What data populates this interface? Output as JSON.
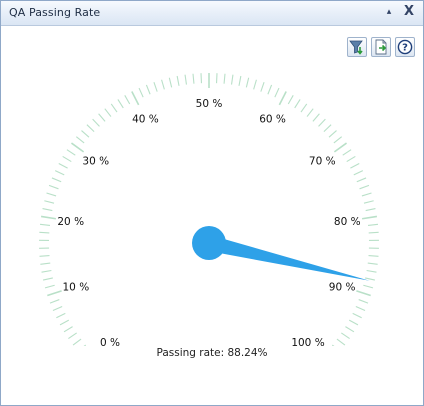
{
  "window": {
    "title": "QA Passing Rate",
    "pin_glyph": "▴",
    "close_glyph": "X"
  },
  "toolbar": {
    "buttons": [
      {
        "name": "filter-button",
        "icon": "filter-icon"
      },
      {
        "name": "export-button",
        "icon": "export-document-icon"
      },
      {
        "name": "help-button",
        "icon": "help-icon"
      }
    ]
  },
  "gauge": {
    "min": 0,
    "max": 100,
    "value": 88.24,
    "tick_labels": [
      "0 %",
      "10 %",
      "20 %",
      "30 %",
      "40 %",
      "50 %",
      "60 %",
      "70 %",
      "80 %",
      "90 %",
      "100 %"
    ],
    "needle_color": "#2ea1e8",
    "tick_color": "#b9e0c8"
  },
  "status": {
    "label": "Passing rate:",
    "value": "88.24%"
  }
}
